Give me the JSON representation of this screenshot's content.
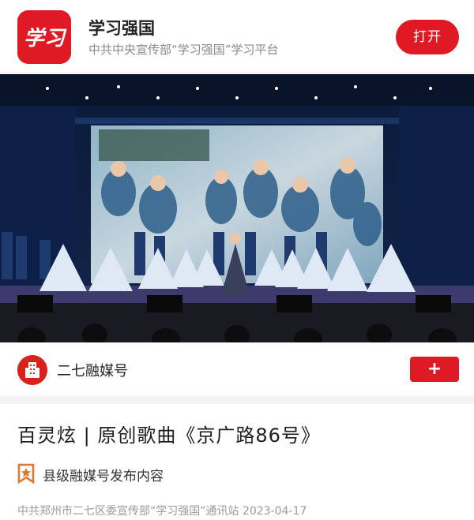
{
  "app_banner": {
    "logo_text": "学习",
    "name": "学习强国",
    "subtitle": "中共中央宣传部“学习强国”学习平台",
    "open_label": "打开"
  },
  "channel": {
    "name": "二七融媒号",
    "follow_label": "+"
  },
  "article": {
    "title": "百灵炫 | 原创歌曲《京广路86号》",
    "badge_text": "县级融媒号发布内容",
    "meta": "中共郑州市二七区委宣传部“学习强国”通讯站  2023-04-17"
  },
  "colors": {
    "brand_red": "#e01a24",
    "stage_blue": "#0f1a30"
  },
  "icons": {
    "badge": "star-bookmark-icon"
  }
}
